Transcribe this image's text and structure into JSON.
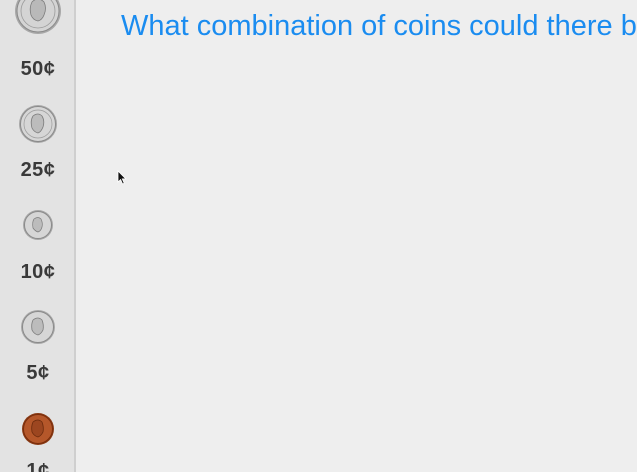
{
  "sidebar": {
    "coins": [
      {
        "icon": "half-dollar-coin-icon",
        "label": "50¢",
        "color": "#c9c9c9"
      },
      {
        "icon": "quarter-coin-icon",
        "label": "25¢",
        "color": "#c9c9c9"
      },
      {
        "icon": "dime-coin-icon",
        "label": "10¢",
        "color": "#c9c9c9"
      },
      {
        "icon": "nickel-coin-icon",
        "label": "5¢",
        "color": "#c9c9c9"
      },
      {
        "icon": "penny-coin-icon",
        "label": "1¢",
        "color": "#b5572a"
      }
    ]
  },
  "main": {
    "question": "What combination of coins could there be"
  },
  "colors": {
    "question_text": "#1a8cf0",
    "sidebar_bg": "#e3e3e3",
    "canvas_bg": "#eeeeee"
  }
}
